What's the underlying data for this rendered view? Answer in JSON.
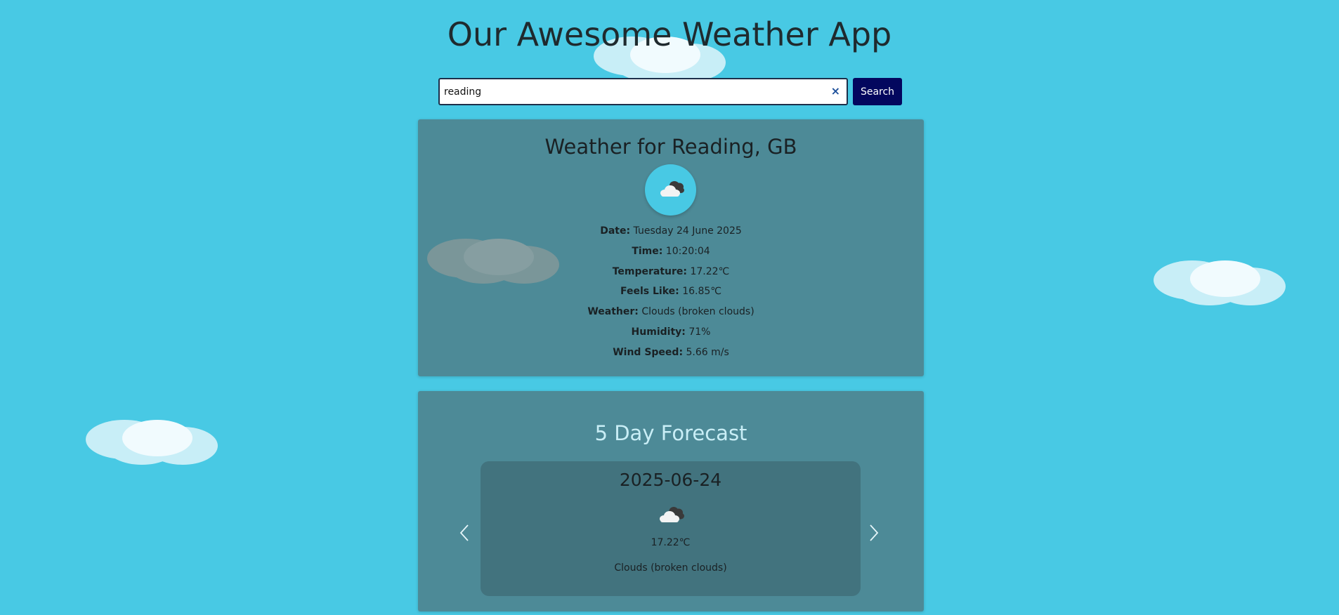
{
  "app": {
    "title": "Our Awesome Weather App"
  },
  "search": {
    "value": "reading",
    "clear_icon": "×",
    "button_label": "Search"
  },
  "current": {
    "heading": "Weather for Reading, GB",
    "icon": "broken-clouds-icon",
    "details": [
      {
        "label": "Date:",
        "value": "Tuesday 24 June 2025"
      },
      {
        "label": "Time:",
        "value": "10:20:04"
      },
      {
        "label": "Temperature:",
        "value": "17.22℃"
      },
      {
        "label": "Feels Like:",
        "value": "16.85℃"
      },
      {
        "label": "Weather:",
        "value": "Clouds (broken clouds)"
      },
      {
        "label": "Humidity:",
        "value": "71%"
      },
      {
        "label": "Wind Speed:",
        "value": "5.66 m/s"
      }
    ]
  },
  "forecast": {
    "heading": "5 Day Forecast",
    "slide": {
      "date": "2025-06-24",
      "icon": "broken-clouds-icon",
      "temperature": "17.22℃",
      "description": "Clouds (broken clouds)"
    }
  },
  "colors": {
    "background": "#48c9e4",
    "search_button": "#03075e",
    "clear_icon": "#1d4f9a",
    "card": "#4e7882"
  }
}
